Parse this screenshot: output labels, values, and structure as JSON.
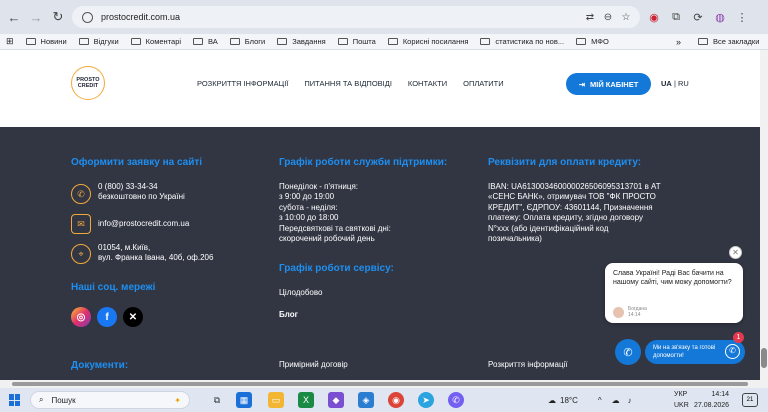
{
  "browser": {
    "url": "prostocredit.com.ua",
    "bookmarks": [
      "Новини",
      "Відгуки",
      "Коментарі",
      "ВА",
      "Блоги",
      "Завдання",
      "Пошта",
      "Корисні посилання",
      "статистика по нов...",
      "МФО"
    ],
    "all_bookmarks": "Все закладки"
  },
  "site_header": {
    "logo_line1": "PROSTO",
    "logo_line2": "CREDIT",
    "nav": [
      "РОЗКРИТТЯ ІНФОРМАЦІЇ",
      "ПИТАННЯ ТА ВІДПОВІДІ",
      "КОНТАКТИ",
      "ОПЛАТИТИ"
    ],
    "cabinet_label": "МІЙ КАБІНЕТ",
    "lang_ua": "UA",
    "lang_sep": "|",
    "lang_ru": "RU"
  },
  "footer": {
    "apply_title": "Оформити заявку на сайті",
    "phone": "0 (800) 33-34-34",
    "phone_note": "безкоштовно по Україні",
    "email": "info@prostocredit.com.ua",
    "address_line1": "01054, м.Київ,",
    "address_line2": "вул. Франка Івана, 40б, оф.206",
    "social_title": "Наші соц. мережі",
    "support_title": "Графік роботи служби підтримки:",
    "support_lines": [
      "Понеділок - п'ятниця:",
      "з 9:00 до 19:00",
      "субота - неділя:",
      "з 10:00 до 18:00",
      "Передсвяткові та святкові дні:",
      "скорочений робочий день"
    ],
    "service_title": "Графік роботи сервісу:",
    "service_text": "Цілодобово",
    "blog": "Блог",
    "details_title": "Реквізити для оплати кредиту:",
    "details_lines": [
      "IBAN: UA613003460000026506095313701 в АТ",
      "«СЕНС БАНК», отримувач ТОВ \"ФК ПРОСТО",
      "КРЕДИТ\", ЄДРПОУ: 43601144, Призначення",
      "платежу: Оплата кредиту, згідно договору",
      "N°xxx (або ідентифікаційний код",
      "позичальника)"
    ],
    "documents_title": "Документи:",
    "sample_contract": "Примірний договір",
    "disclosure": "Розкриття інформації"
  },
  "chat": {
    "greeting": "Слава Україні! Раді Вас бачити на нашому сайті, чим можу допомогти?",
    "agent_name": "Богдана",
    "agent_time": "14:14",
    "pill_text": "Ми на зв'язку та готові допомогти!",
    "badge": "1"
  },
  "taskbar": {
    "search_label": "Пошук",
    "temperature": "18°C",
    "lang_line1": "УКР",
    "lang_line2": "UKR",
    "time": "14:14",
    "date": "27.08.2026",
    "notifications": "21"
  },
  "colors": {
    "accent_blue": "#1378d8",
    "footer_bg": "#323643",
    "title_blue": "#1d8ff2",
    "logo_orange": "#f2a93b"
  }
}
